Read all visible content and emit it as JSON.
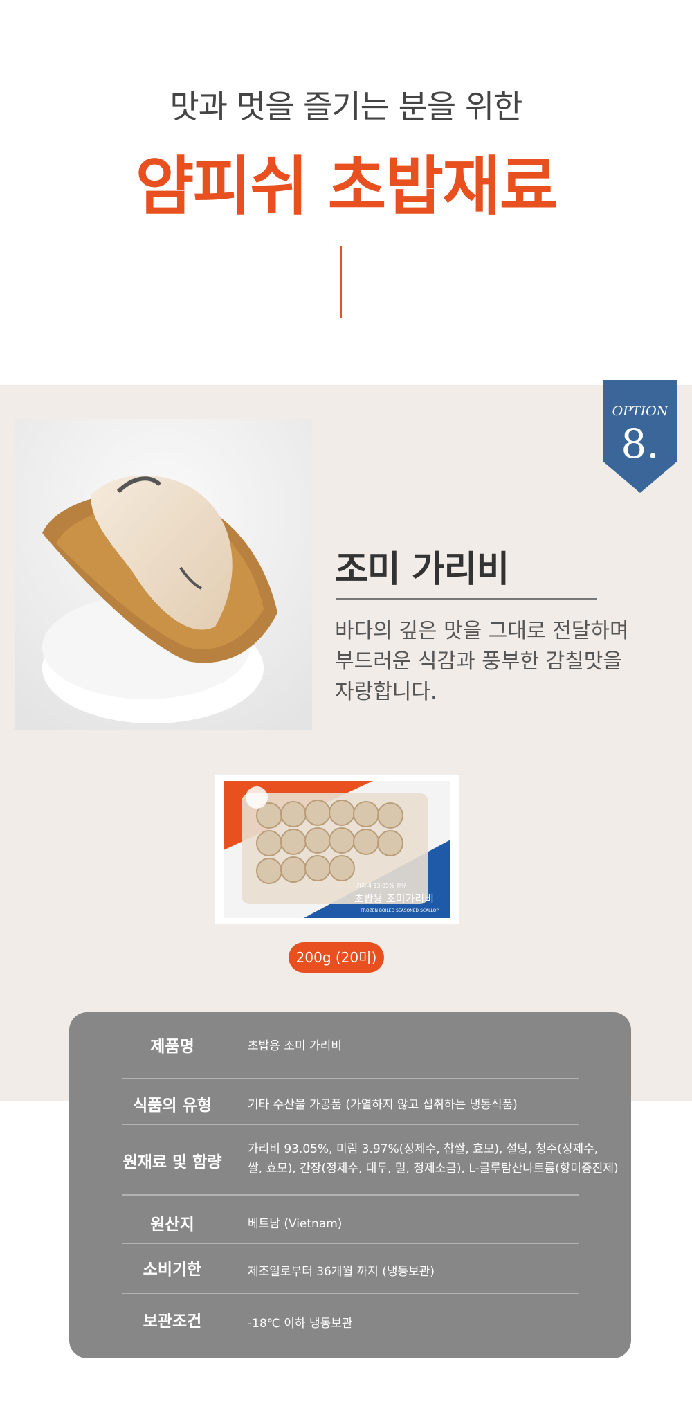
{
  "header": {
    "subtitle": "맛과 멋을 즐기는 분을 위한",
    "title": "얌피쉬 초밥재료"
  },
  "badge": {
    "label": "OPTION",
    "number": "8.",
    "color": "#3a6699"
  },
  "product": {
    "name": "조미 가리비",
    "description": [
      "바다의 깊은 맛을 그대로 전달하며",
      "부드러운 식감과 풍부한 감칠맛을",
      "자랑합니다."
    ],
    "package_labels": {
      "main": "초밥용 조미가리비",
      "small": "FROZEN BOILED SEASONED SCALLOP",
      "content": "가리비 93.05% 함유"
    },
    "weight_pill": "200g (20미)"
  },
  "info_table": {
    "rows": [
      {
        "label": "제품명",
        "value": [
          "초밥용 조미 가리비"
        ]
      },
      {
        "label": "식품의 유형",
        "value": [
          "기타 수산물 가공품 (가열하지 않고 섭취하는 냉동식품)"
        ]
      },
      {
        "label": "원재료 및 함량",
        "value": [
          "가리비 93.05%, 미림 3.97%(정제수, 찹쌀, 효모), 설탕, 청주(정제수,",
          "쌀, 효모), 간장(정제수, 대두, 밀, 정제소금), L-글루탐산나트륨(향미증진제)"
        ]
      },
      {
        "label": "원산지",
        "value": [
          "베트남 (Vietnam)"
        ]
      },
      {
        "label": "소비기한",
        "value": [
          "제조일로부터 36개월 까지 (냉동보관)"
        ]
      },
      {
        "label": "보관조건",
        "value": [
          "-18℃ 이하 냉동보관"
        ]
      }
    ]
  },
  "colors": {
    "accent": "#e8501f",
    "band": "#f1ece8",
    "table": "#878787"
  }
}
